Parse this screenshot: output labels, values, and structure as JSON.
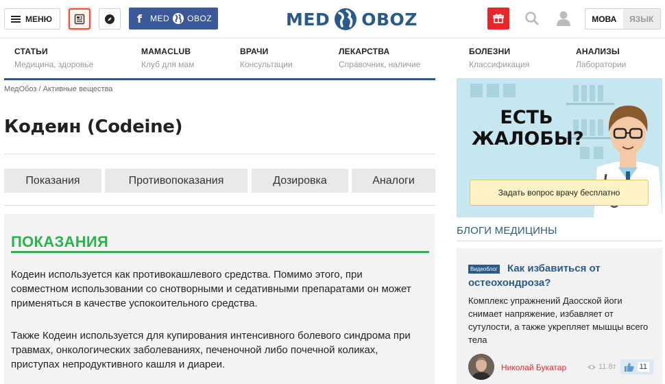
{
  "header": {
    "menu_label": "МЕНЮ",
    "facebook_label": "MED",
    "facebook_label_2": "OBOZ",
    "logo_left": "MED",
    "logo_right": "OBOZ",
    "lang_active": "МОВА",
    "lang_inactive": "ЯЗЫК"
  },
  "nav": [
    {
      "title": "СТАТЬИ",
      "sub": "Медицина, здоровье"
    },
    {
      "title": "MAMACLUB",
      "sub": "Клуб для мам"
    },
    {
      "title": "ВРАЧИ",
      "sub": "Консультации"
    },
    {
      "title": "ЛЕКАРСТВА",
      "sub": "Справочник, наличие"
    },
    {
      "title": "БОЛЕЗНИ",
      "sub": "Классификация"
    },
    {
      "title": "АНАЛИЗЫ",
      "sub": "Лаборатории"
    }
  ],
  "breadcrumb": {
    "home": "МедОбоз",
    "sep": " / ",
    "current": "Активные вещества"
  },
  "page_title": "Кодеин (Codeine)",
  "tabs": [
    "Показания",
    "Противопоказания",
    "Дозировка",
    "Аналоги"
  ],
  "section": {
    "heading": "ПОКАЗАНИЯ",
    "p1": "Кодеин используется как противокашлевого средства. Помимо этого, при совместном использовании со снотворными и седативными препаратами он может применяться в качестве успокоительного средства.",
    "p2": "Также Кодеин используется для купирования интенсивного болевого синдрома при травмах, онкологических заболеваниях, печеночной либо почечной коликах, приступах непродуктивного кашля и диареи."
  },
  "banner": {
    "question_1": "ЕСТЬ",
    "question_2": "ЖАЛОБЫ?",
    "cta": "Задать вопрос врачу бесплатно"
  },
  "blogs": {
    "heading": "БЛОГИ МЕДИЦИНЫ",
    "badge": "Видеоблог",
    "title": "Как избавиться от остеохондроза?",
    "text": "Комплекс упражнений Даосской йоги снимает напряжение, избавляет от сутулости, а также укрепляет мышцы всего тела",
    "author": "Николай Букатар",
    "views": "11.8т",
    "likes": "11"
  },
  "colors": {
    "brand_blue": "#2a5a8a",
    "accent_green": "#2bb24c",
    "accent_red": "#e8262c",
    "facebook": "#3b5998"
  }
}
